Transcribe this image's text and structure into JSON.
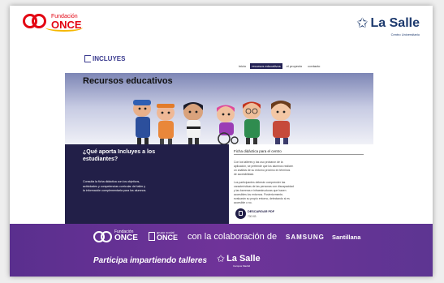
{
  "top": {
    "once_logo": {
      "fundacion": "Fundación",
      "once": "ONCE"
    },
    "lasalle_logo": {
      "name": "La Salle",
      "sub": "Centro Universitario"
    }
  },
  "site": {
    "logo": "INCLUYES",
    "nav": [
      "inicio",
      "recursos educativos",
      "el proyecto",
      "contacto"
    ],
    "hero_title": "Recursos educativos",
    "left_panel": {
      "question": "¿Qué aporta Incluyes a los estudiantes?",
      "text": "Consulta la ficha didáctica con los objetivos, actividades y competencias curricular del taller y la información complementaria para los alumnos."
    },
    "right_panel": {
      "title": "Ficha didáctica para el centro",
      "p1": "Con los talleres y las uso probaron de la aplicación, se pretende que los alumnos realicen un análisis de su entorno próximo en términos de accesibilidad.",
      "p2": "Los participantes deberán comprender las características de las personas con discapacidad y las barreras e infraestructuras que hacen accesibles los entornos. Posteriormente, evaluarán su propio entorno, detectando si es accesible o no.",
      "download_label": "DESCARGAR PDF",
      "download_size": "700 KB"
    }
  },
  "footer": {
    "once": {
      "fundacion": "Fundación",
      "once": "ONCE"
    },
    "grupo": {
      "grupo": "grupo social",
      "once": "ONCE"
    },
    "colaboracion": "con la colaboración de",
    "samsung": "SAMSUNG",
    "santillana": "Santillana",
    "participa": "Participa impartiendo talleres",
    "lasalle": {
      "name": "La Salle",
      "sub": "Campus Madrid"
    }
  },
  "colors": {
    "once_red": "#e30613",
    "lasalle_blue": "#1d3a6e",
    "navy": "#221f48",
    "footer_purple": "#6f3399"
  },
  "icons": [
    "once-rings-icon",
    "lasalle-star-icon",
    "incluyes-logo-icon",
    "pdf-download-icon",
    "grupo-social-icon"
  ]
}
